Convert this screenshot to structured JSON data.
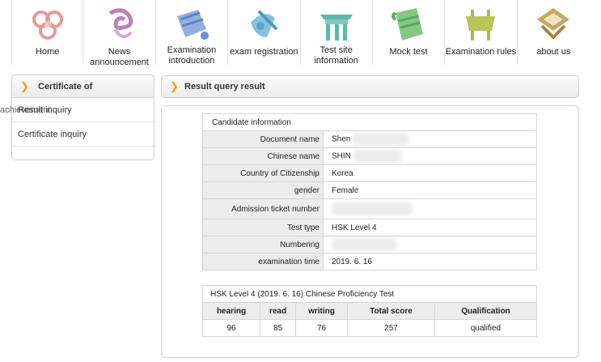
{
  "nav": [
    {
      "label": "Home",
      "icon": "cloud-ornament-icon",
      "color": "#e9a0a0"
    },
    {
      "label": "News announcement",
      "icon": "scroll-swirl-icon",
      "color": "#c58ac0"
    },
    {
      "label": "Examination introduction",
      "icon": "document-pen-icon",
      "color": "#7f9ed6"
    },
    {
      "label": "exam registration",
      "icon": "writing-hand-icon",
      "color": "#72b4d3"
    },
    {
      "label": "Test site information",
      "icon": "gate-building-icon",
      "color": "#68c3b3"
    },
    {
      "label": "Mock test",
      "icon": "paper-roll-icon",
      "color": "#7fc27a"
    },
    {
      "label": "Examination rules",
      "icon": "bronze-vessel-icon",
      "color": "#b7c55a"
    },
    {
      "label": "about us",
      "icon": "pavilion-icon",
      "color": "#b89a52"
    }
  ],
  "sidebar": {
    "title": "Certificate of",
    "ghost_text": "achievement",
    "items": [
      "Result inquiry",
      "Certificate inquiry"
    ]
  },
  "main": {
    "title": "Result query result",
    "candidate": {
      "caption": "Candidate information",
      "rows": [
        {
          "label": "Document name",
          "value": "Shen"
        },
        {
          "label": "Chinese name",
          "value": "SHIN"
        },
        {
          "label": "Country of Citizenship",
          "value": "Korea"
        },
        {
          "label": "gender",
          "value": "Female"
        },
        {
          "label": "Admission ticket number",
          "value": ""
        },
        {
          "label": "Test type",
          "value": "HSK Level 4"
        },
        {
          "label": "Numbering",
          "value": ""
        },
        {
          "label": "examination time",
          "value": "2019. 6. 16"
        }
      ]
    },
    "scores": {
      "caption": "HSK Level 4 (2019. 6. 16) Chinese Proficiency Test",
      "headers": [
        "hearing",
        "read",
        "writing",
        "Total score",
        "Qualification"
      ],
      "values": [
        "96",
        "85",
        "76",
        "257",
        "qualified"
      ]
    }
  },
  "colors": {
    "accent": "#f0a000",
    "header_bg": "#ececec",
    "border": "#d6d6d6"
  }
}
